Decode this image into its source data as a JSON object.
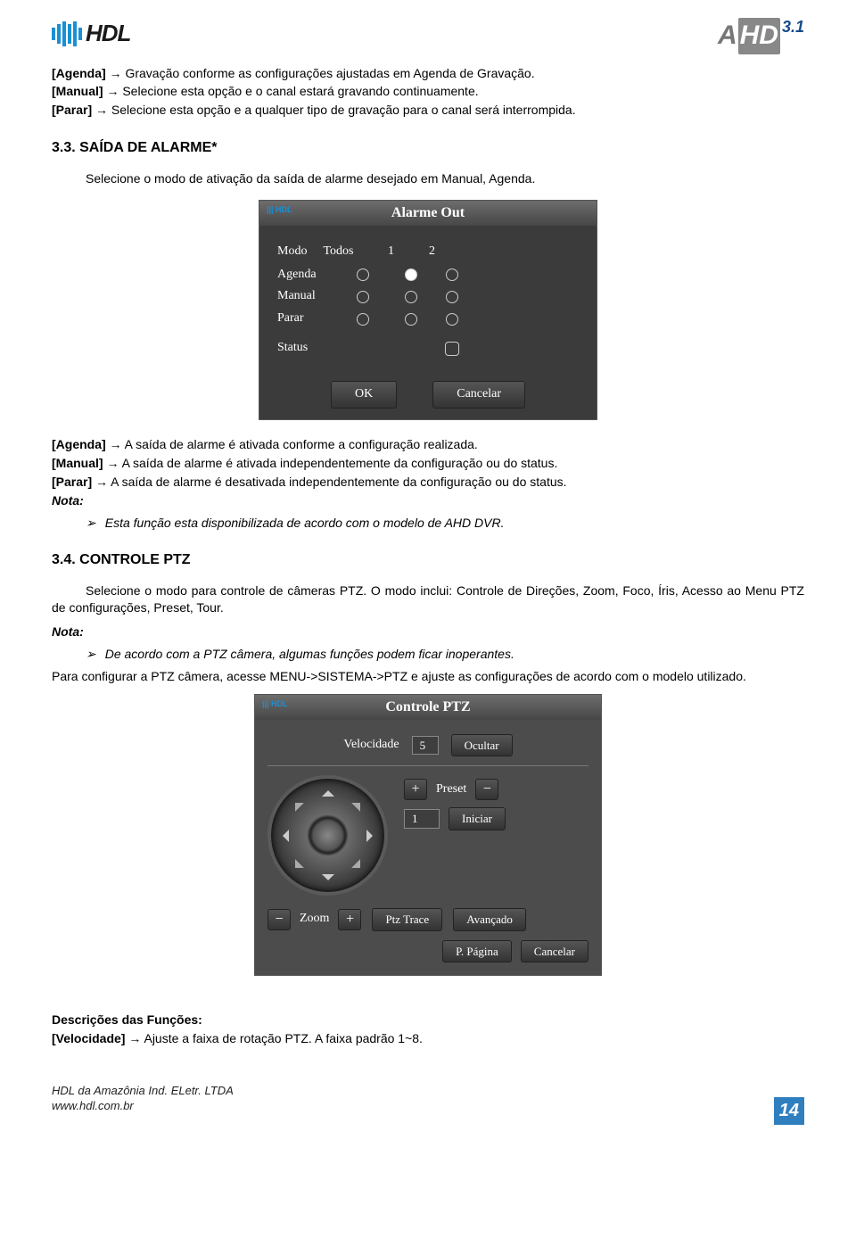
{
  "header": {
    "logo_text": "HDL",
    "brand": "AHD",
    "brand_version": "3.1"
  },
  "intro": {
    "agenda_label": "[Agenda]",
    "agenda_text": " Gravação conforme as configurações ajustadas em Agenda de Gravação.",
    "manual_label": "[Manual]",
    "manual_text": " Selecione esta opção e o canal estará gravando continuamente.",
    "parar_label": "[Parar]",
    "parar_text": " Selecione esta opção e a qualquer tipo de gravação para o canal será interrompida."
  },
  "section33": {
    "heading": "3.3.    SAÍDA DE ALARME*",
    "desc": "Selecione o modo de ativação da saída de alarme desejado em Manual, Agenda."
  },
  "shot1": {
    "title": "Alarme Out",
    "cols": {
      "modo": "Modo",
      "todos": "Todos",
      "c1": "1",
      "c2": "2"
    },
    "rows": {
      "agenda": "Agenda",
      "manual": "Manual",
      "parar": "Parar",
      "status": "Status"
    },
    "ok": "OK",
    "cancel": "Cancelar"
  },
  "post1": {
    "agenda_label": "[Agenda]",
    "agenda_text": " A saída de alarme é ativada conforme a configuração realizada.",
    "manual_label": "[Manual]",
    "manual_text": " A saída de alarme é ativada independentemente da configuração ou do status.",
    "parar_label": "[Parar]",
    "parar_text": " A saída de alarme é desativada independentemente da configuração ou do status.",
    "nota": "Nota:",
    "bullet1": "Esta função esta disponibilizada de acordo com o modelo de AHD DVR."
  },
  "section34": {
    "heading": "3.4.    CONTROLE PTZ",
    "desc": "Selecione o modo para controle de câmeras PTZ. O modo inclui: Controle de Direções, Zoom, Foco, Íris, Acesso ao Menu PTZ de configurações, Preset, Tour.",
    "nota": "Nota:",
    "bullet1": "De acordo com a PTZ câmera, algumas funções podem ficar inoperantes.",
    "config": "Para configurar a PTZ câmera, acesse MENU->SISTEMA->PTZ e ajuste as configurações de acordo com o modelo utilizado."
  },
  "shot2": {
    "title": "Controle PTZ",
    "velocidade_lbl": "Velocidade",
    "velocidade_val": "5",
    "ocultar": "Ocultar",
    "preset_lbl": "Preset",
    "preset_val": "1",
    "iniciar": "Iniciar",
    "zoom_lbl": "Zoom",
    "ptztrace": "Ptz Trace",
    "avancado": "Avançado",
    "ppagina": "P. Página",
    "cancelar": "Cancelar"
  },
  "funcdesc": {
    "heading": "Descrições das Funções:",
    "vel_label": "[Velocidade]",
    "vel_text": " Ajuste a faixa de rotação PTZ. A faixa padrão 1~8."
  },
  "footer": {
    "line1": "HDL da Amazônia Ind. ELetr. LTDA",
    "line2": "www.hdl.com.br"
  },
  "page_number": "14"
}
